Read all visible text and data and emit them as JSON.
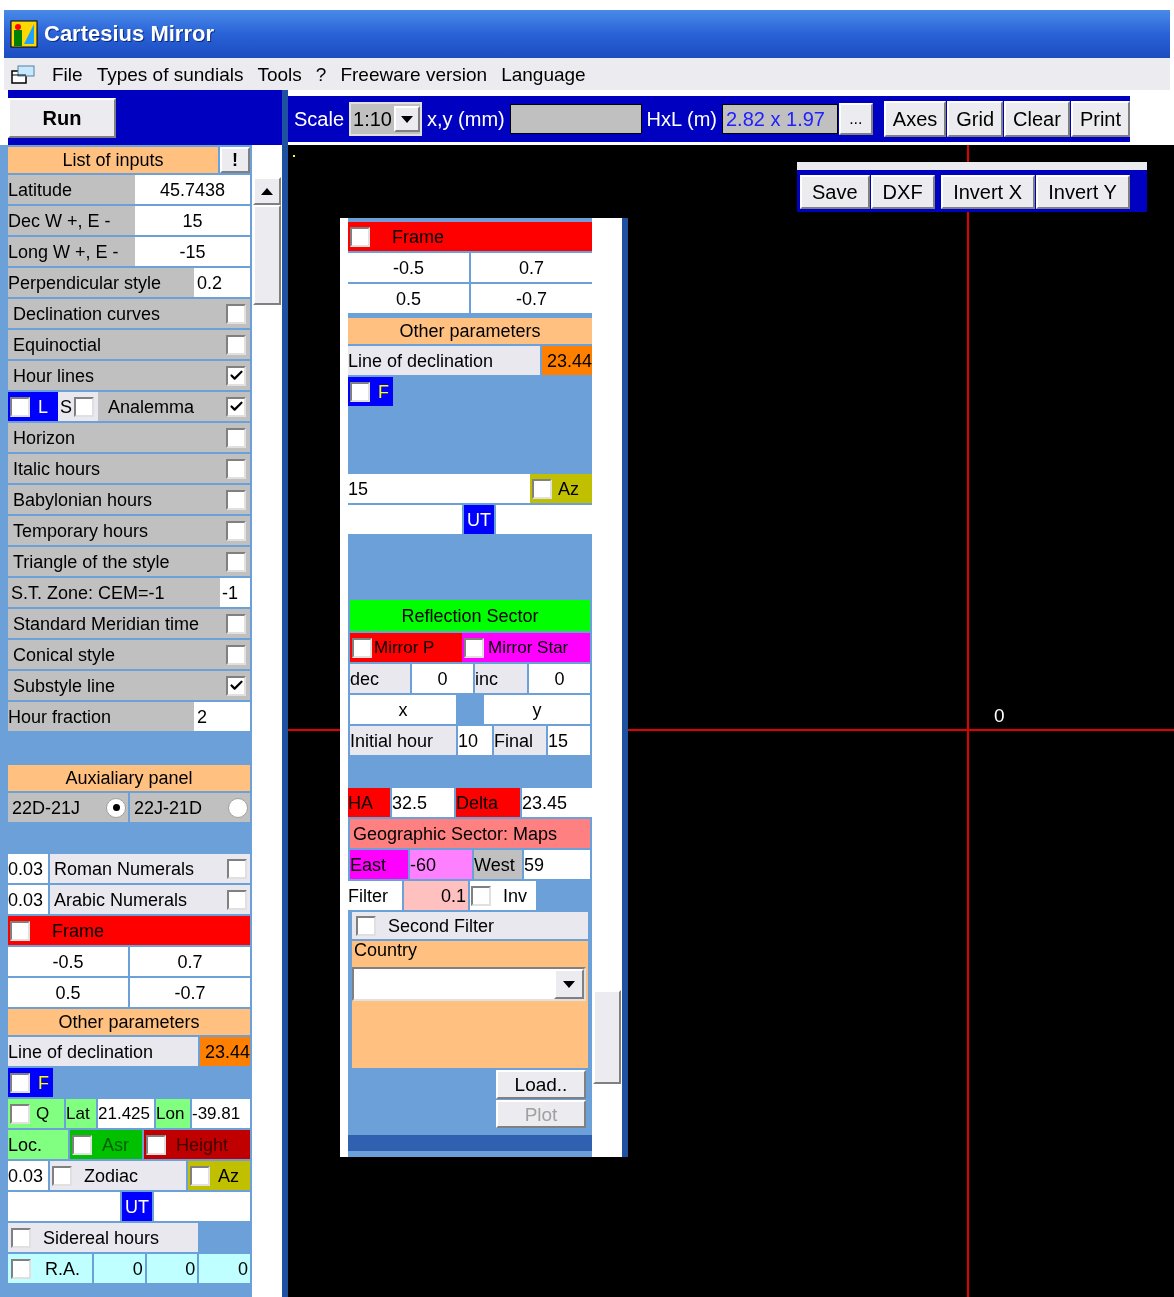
{
  "window": {
    "title": "Cartesius Mirror"
  },
  "menu": [
    "File",
    "Types of sundials",
    "Tools",
    "?",
    "Freeware version",
    "Language"
  ],
  "run_button": "Run",
  "toolbar": {
    "scale_label": "Scale",
    "scale_value": "1:10",
    "xy_label": "x,y (mm)",
    "hxl_label": "HxL (m)",
    "hxl_value": "2.82 x 1.97",
    "more_button": "...",
    "buttons": [
      "Axes",
      "Grid",
      "Clear",
      "Print"
    ]
  },
  "inputs_panel": {
    "title": "List of inputs",
    "alert_button": "!",
    "rows": [
      {
        "kind": "field",
        "label": "Latitude",
        "value": "45.7438"
      },
      {
        "kind": "field",
        "label": "Dec W +, E -",
        "value": "15"
      },
      {
        "kind": "field",
        "label": "Long W +, E -",
        "value": "-15"
      },
      {
        "kind": "short_field",
        "label": "Perpendicular style",
        "value": "0.2"
      },
      {
        "kind": "check",
        "label": "Declination curves",
        "checked": false
      },
      {
        "kind": "check",
        "label": "Equinoctial",
        "checked": false
      },
      {
        "kind": "check",
        "label": "Hour lines",
        "checked": true
      },
      {
        "kind": "analemma",
        "l_label": "L",
        "l_checked": false,
        "s_label": "S",
        "s_checked": false,
        "label": "Analemma",
        "checked": true
      },
      {
        "kind": "check",
        "label": "Horizon",
        "checked": false
      },
      {
        "kind": "check",
        "label": "Italic hours",
        "checked": false
      },
      {
        "kind": "check",
        "label": "Babylonian hours",
        "checked": false
      },
      {
        "kind": "check",
        "label": "Temporary hours",
        "checked": false
      },
      {
        "kind": "check",
        "label": "Triangle of the style",
        "checked": false
      },
      {
        "kind": "tiny_field",
        "label": "S.T. Zone: CEM=-1",
        "value": "-1"
      },
      {
        "kind": "check",
        "label": "Standard Meridian time",
        "checked": false
      },
      {
        "kind": "check",
        "label": "Conical style",
        "checked": false
      },
      {
        "kind": "check",
        "label": "Substyle line",
        "checked": true
      },
      {
        "kind": "short_field",
        "label": "Hour fraction",
        "value": "2"
      }
    ]
  },
  "auxiliary": {
    "title": "Auxialiary panel",
    "options": [
      {
        "label": "22D-21J",
        "selected": true
      },
      {
        "label": "22J-21D",
        "selected": false
      }
    ],
    "numerals": [
      {
        "size": "0.03",
        "label": "Roman Numerals",
        "checked": false
      },
      {
        "size": "0.03",
        "label": "Arabic Numerals",
        "checked": false
      }
    ],
    "frame": {
      "label": "Frame",
      "checked": false,
      "values": [
        "-0.5",
        "0.7",
        "0.5",
        "-0.7"
      ]
    },
    "other_parameters": {
      "title": "Other parameters",
      "declination_label": "Line of declination",
      "declination_value": "23.44"
    },
    "f_option": {
      "label": "F",
      "checked": false
    },
    "q_row": {
      "label": "Q",
      "checked": false,
      "lat_label": "Lat",
      "lat_value": "21.425",
      "lon_label": "Lon",
      "lon_value": "-39.81"
    },
    "loc_row": {
      "label": "Loc.",
      "asr": {
        "label": "Asr",
        "checked": false
      },
      "height": {
        "label": "Height",
        "checked": false
      }
    },
    "zodiac_row": {
      "size": "0.03",
      "label": "Zodiac",
      "checked": false,
      "az": {
        "label": "Az",
        "checked": false
      }
    },
    "ut_label": "UT",
    "sidereal": {
      "label": "Sidereal hours",
      "checked": false
    },
    "ra_row": {
      "label": "R.A.",
      "checked": false,
      "values": [
        "0",
        "0",
        "0"
      ]
    }
  },
  "canvas": {
    "origin_label": "0",
    "file_buttons": [
      "Save",
      "DXF"
    ],
    "invert_buttons": [
      "Invert X",
      "Invert Y"
    ]
  },
  "floating_panel": {
    "frame": {
      "label": "Frame",
      "checked": false,
      "values": [
        "-0.5",
        "0.7",
        "0.5",
        "-0.7"
      ]
    },
    "other_parameters": {
      "title": "Other parameters",
      "declination_label": "Line of declination",
      "declination_value": "23.44"
    },
    "f_option": {
      "label": "F",
      "checked": false
    },
    "az_row": {
      "value": "15",
      "az_label": "Az",
      "az_checked": false
    },
    "ut_label": "UT",
    "reflection": {
      "title": "Reflection Sector",
      "mirror_p": {
        "label": "Mirror P",
        "checked": false
      },
      "mirror_star": {
        "label": "Mirror Star",
        "checked": false
      },
      "dec_label": "dec",
      "dec_value": "0",
      "inc_label": "inc",
      "inc_value": "0",
      "x_label": "x",
      "y_label": "y",
      "initial_label": "Initial hour",
      "initial_value": "10",
      "final_label": "Final",
      "final_value": "15"
    },
    "ha_label": "HA",
    "ha_value": "32.5",
    "delta_label": "Delta",
    "delta_value": "23.45",
    "geographic": {
      "title": "Geographic Sector: Maps",
      "east_label": "East",
      "east_value": "-60",
      "west_label": "West",
      "west_value": "59",
      "filter_label": "Filter",
      "filter_value": "0.1",
      "inv": {
        "label": "Inv",
        "checked": false
      },
      "second_filter": {
        "label": "Second Filter",
        "checked": false
      },
      "country_label": "Country"
    },
    "load_button": "Load..",
    "plot_button": {
      "label": "Plot",
      "disabled": true
    }
  }
}
